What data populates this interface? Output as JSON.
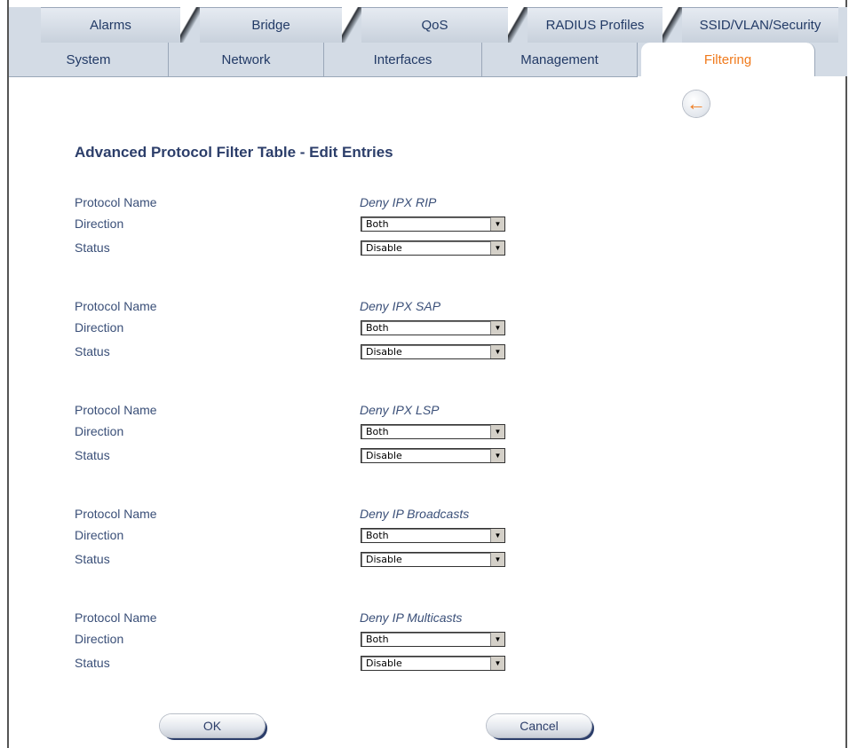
{
  "tabs_top": [
    "Alarms",
    "Bridge",
    "QoS",
    "RADIUS Profiles",
    "SSID/VLAN/Security"
  ],
  "tabs_bottom": [
    "System",
    "Network",
    "Interfaces",
    "Management",
    "Filtering"
  ],
  "active_tab": "Filtering",
  "title": "Advanced Protocol Filter Table - Edit Entries",
  "labels": {
    "protocol_name": "Protocol Name",
    "direction": "Direction",
    "status": "Status"
  },
  "entries": [
    {
      "name": "Deny IPX RIP",
      "direction": "Both",
      "status": "Disable"
    },
    {
      "name": "Deny IPX SAP",
      "direction": "Both",
      "status": "Disable"
    },
    {
      "name": "Deny IPX LSP",
      "direction": "Both",
      "status": "Disable"
    },
    {
      "name": "Deny IP Broadcasts",
      "direction": "Both",
      "status": "Disable"
    },
    {
      "name": "Deny IP Multicasts",
      "direction": "Both",
      "status": "Disable"
    }
  ],
  "buttons": {
    "ok": "OK",
    "cancel": "Cancel"
  },
  "icons": {
    "back": "back-arrow-icon",
    "dropdown": "chevron-down-icon"
  },
  "colors": {
    "active_tab_text": "#f07a1c",
    "text_primary": "#2c3e6a"
  }
}
